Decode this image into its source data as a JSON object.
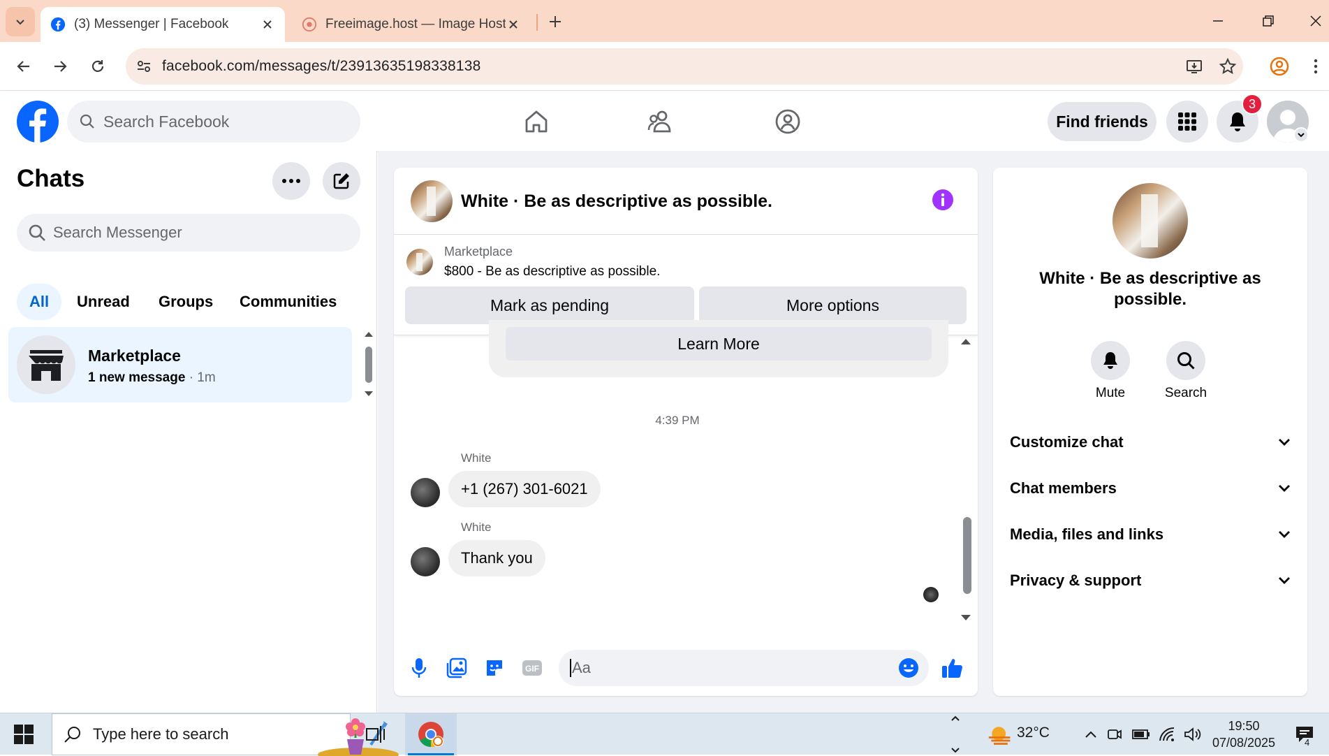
{
  "browser": {
    "tabs": [
      {
        "title": "(3) Messenger | Facebook"
      },
      {
        "title": "Freeimage.host — Image Hostin"
      }
    ],
    "url": "facebook.com/messages/t/23913635198338138"
  },
  "fb": {
    "search_placeholder": "Search Facebook",
    "find_friends": "Find friends",
    "notifications_count": "3"
  },
  "sidebar": {
    "title": "Chats",
    "search_placeholder": "Search Messenger",
    "filters": [
      "All",
      "Unread",
      "Groups",
      "Communities"
    ],
    "chat": {
      "name": "Marketplace",
      "preview": "1 new message",
      "time": " · 1m"
    }
  },
  "conversation": {
    "title": "White · Be as descriptive as possible.",
    "marketplace_label": "Marketplace",
    "listing": "$800 - Be as descriptive as possible.",
    "mark_pending": "Mark as pending",
    "more_options": "More options",
    "learn_more": "Learn More",
    "timestamp": "4:39 PM",
    "messages": [
      {
        "sender": "White",
        "text": "+1 (267) 301-6021"
      },
      {
        "sender": "White",
        "text": "Thank you"
      }
    ],
    "input_placeholder": "Aa"
  },
  "details": {
    "name": "White · Be as descriptive as possible.",
    "actions": [
      "Mute",
      "Search"
    ],
    "sections": [
      "Customize chat",
      "Chat members",
      "Media, files and links",
      "Privacy & support"
    ]
  },
  "taskbar": {
    "search_placeholder": "Type here to search",
    "temperature": "32°C",
    "time": "19:50",
    "date": "07/08/2025",
    "notification_count": "4"
  },
  "colors": {
    "fb_blue": "#0866ff",
    "messenger_purple": "#a033ff",
    "chrome_frame": "#fad9c8"
  }
}
